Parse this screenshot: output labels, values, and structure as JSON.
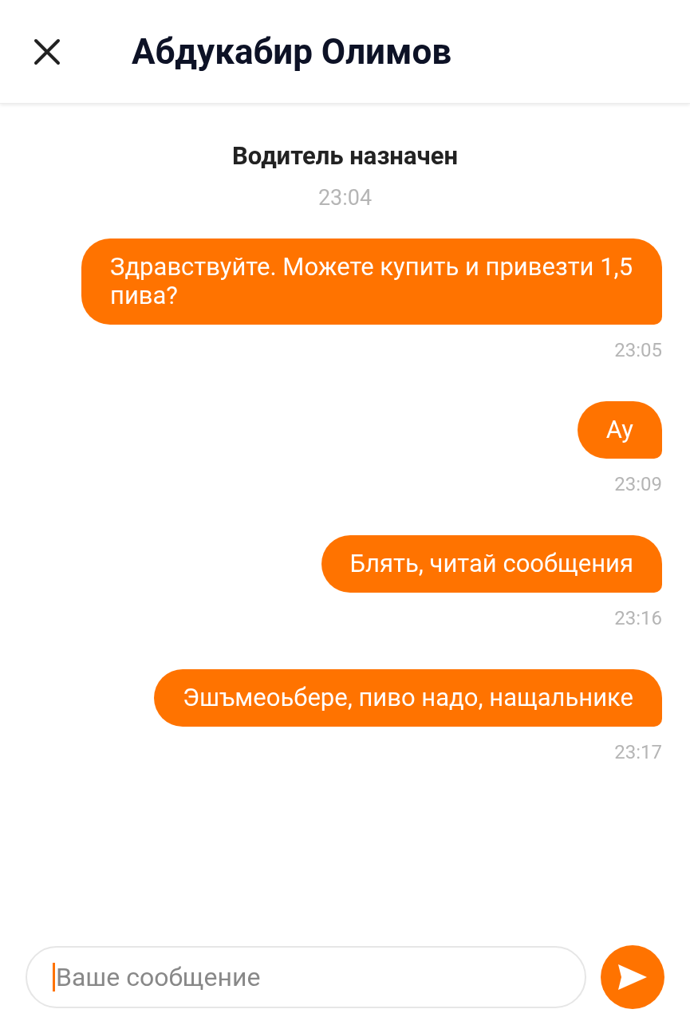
{
  "header": {
    "title": "Абдукабир Олимов"
  },
  "system": {
    "text": "Водитель назначен",
    "time": "23:04"
  },
  "messages": [
    {
      "text": "Здравствуйте. Можете купить и привезти 1,5 пива?",
      "time": "23:05"
    },
    {
      "text": "Ау",
      "time": "23:09"
    },
    {
      "text": "Блять, читай сообщения",
      "time": "23:16"
    },
    {
      "text": "Эшъмеоьбере, пиво надо, нащальнике",
      "time": "23:17"
    }
  ],
  "input": {
    "placeholder": "Ваше сообщение"
  }
}
